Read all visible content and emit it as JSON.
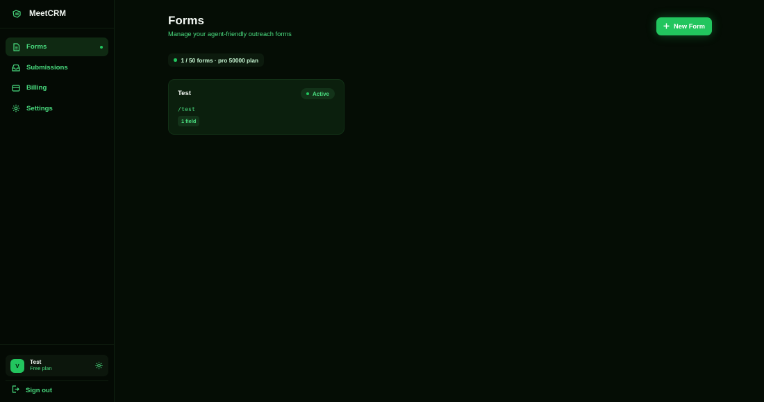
{
  "app": {
    "name": "MeetCRM"
  },
  "sidebar": {
    "items": [
      {
        "label": "Forms",
        "icon": "document-icon",
        "active": true
      },
      {
        "label": "Submissions",
        "icon": "inbox-icon",
        "active": false
      },
      {
        "label": "Billing",
        "icon": "credit-card-icon",
        "active": false
      },
      {
        "label": "Settings",
        "icon": "gear-icon",
        "active": false
      }
    ]
  },
  "user": {
    "initial": "V",
    "name": "Test",
    "plan": "Free plan",
    "signout_label": "Sign out"
  },
  "page": {
    "title": "Forms",
    "subtitle": "Manage your agent-friendly outreach forms",
    "new_button_label": "New Form",
    "usage": "1 / 50 forms · pro 50000 plan"
  },
  "forms": [
    {
      "title": "Test",
      "status": "Active",
      "slug": "/test",
      "fields": "1 field"
    }
  ],
  "colors": {
    "background": "#050d05",
    "accent": "#22c55e",
    "accent_text": "#4ade80"
  }
}
